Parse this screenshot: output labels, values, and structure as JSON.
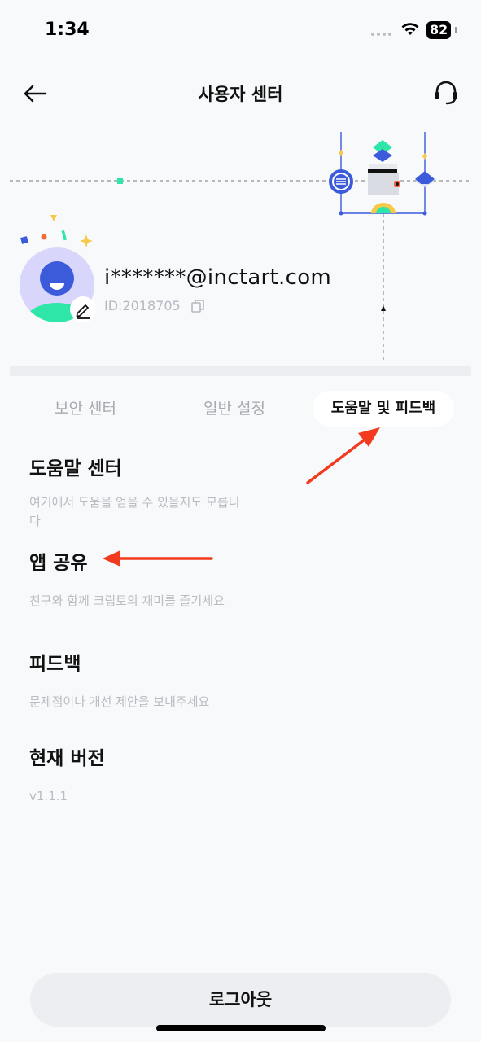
{
  "status_bar": {
    "time": "1:34",
    "battery": "82"
  },
  "header": {
    "title": "사용자 센터",
    "back_icon": "arrow-left-icon",
    "support_icon": "headset-icon"
  },
  "profile": {
    "email": "i*******@inctart.com",
    "id_text": "ID:2018705"
  },
  "tabs": [
    {
      "label": "보안 센터",
      "active": false
    },
    {
      "label": "일반 설정",
      "active": false
    },
    {
      "label": "도움말 및 피드백",
      "active": true
    }
  ],
  "sections": [
    {
      "title": "도움말 센터",
      "desc": "여기에서 도움을 얻을 수 있을지도 모릅니다"
    },
    {
      "title": "앱 공유",
      "desc": "친구와 함께 크립토의 재미를 즐기세요"
    },
    {
      "title": "피드백",
      "desc": "문제점이나 개선 제안을 보내주세요"
    },
    {
      "title": "현재 버전",
      "desc": "v1.1.1"
    }
  ],
  "logout": {
    "label": "로그아웃"
  },
  "colors": {
    "accent_blue": "#3b5bdb",
    "accent_green": "#2ee6a8",
    "annotation_red": "#f23a1e"
  }
}
